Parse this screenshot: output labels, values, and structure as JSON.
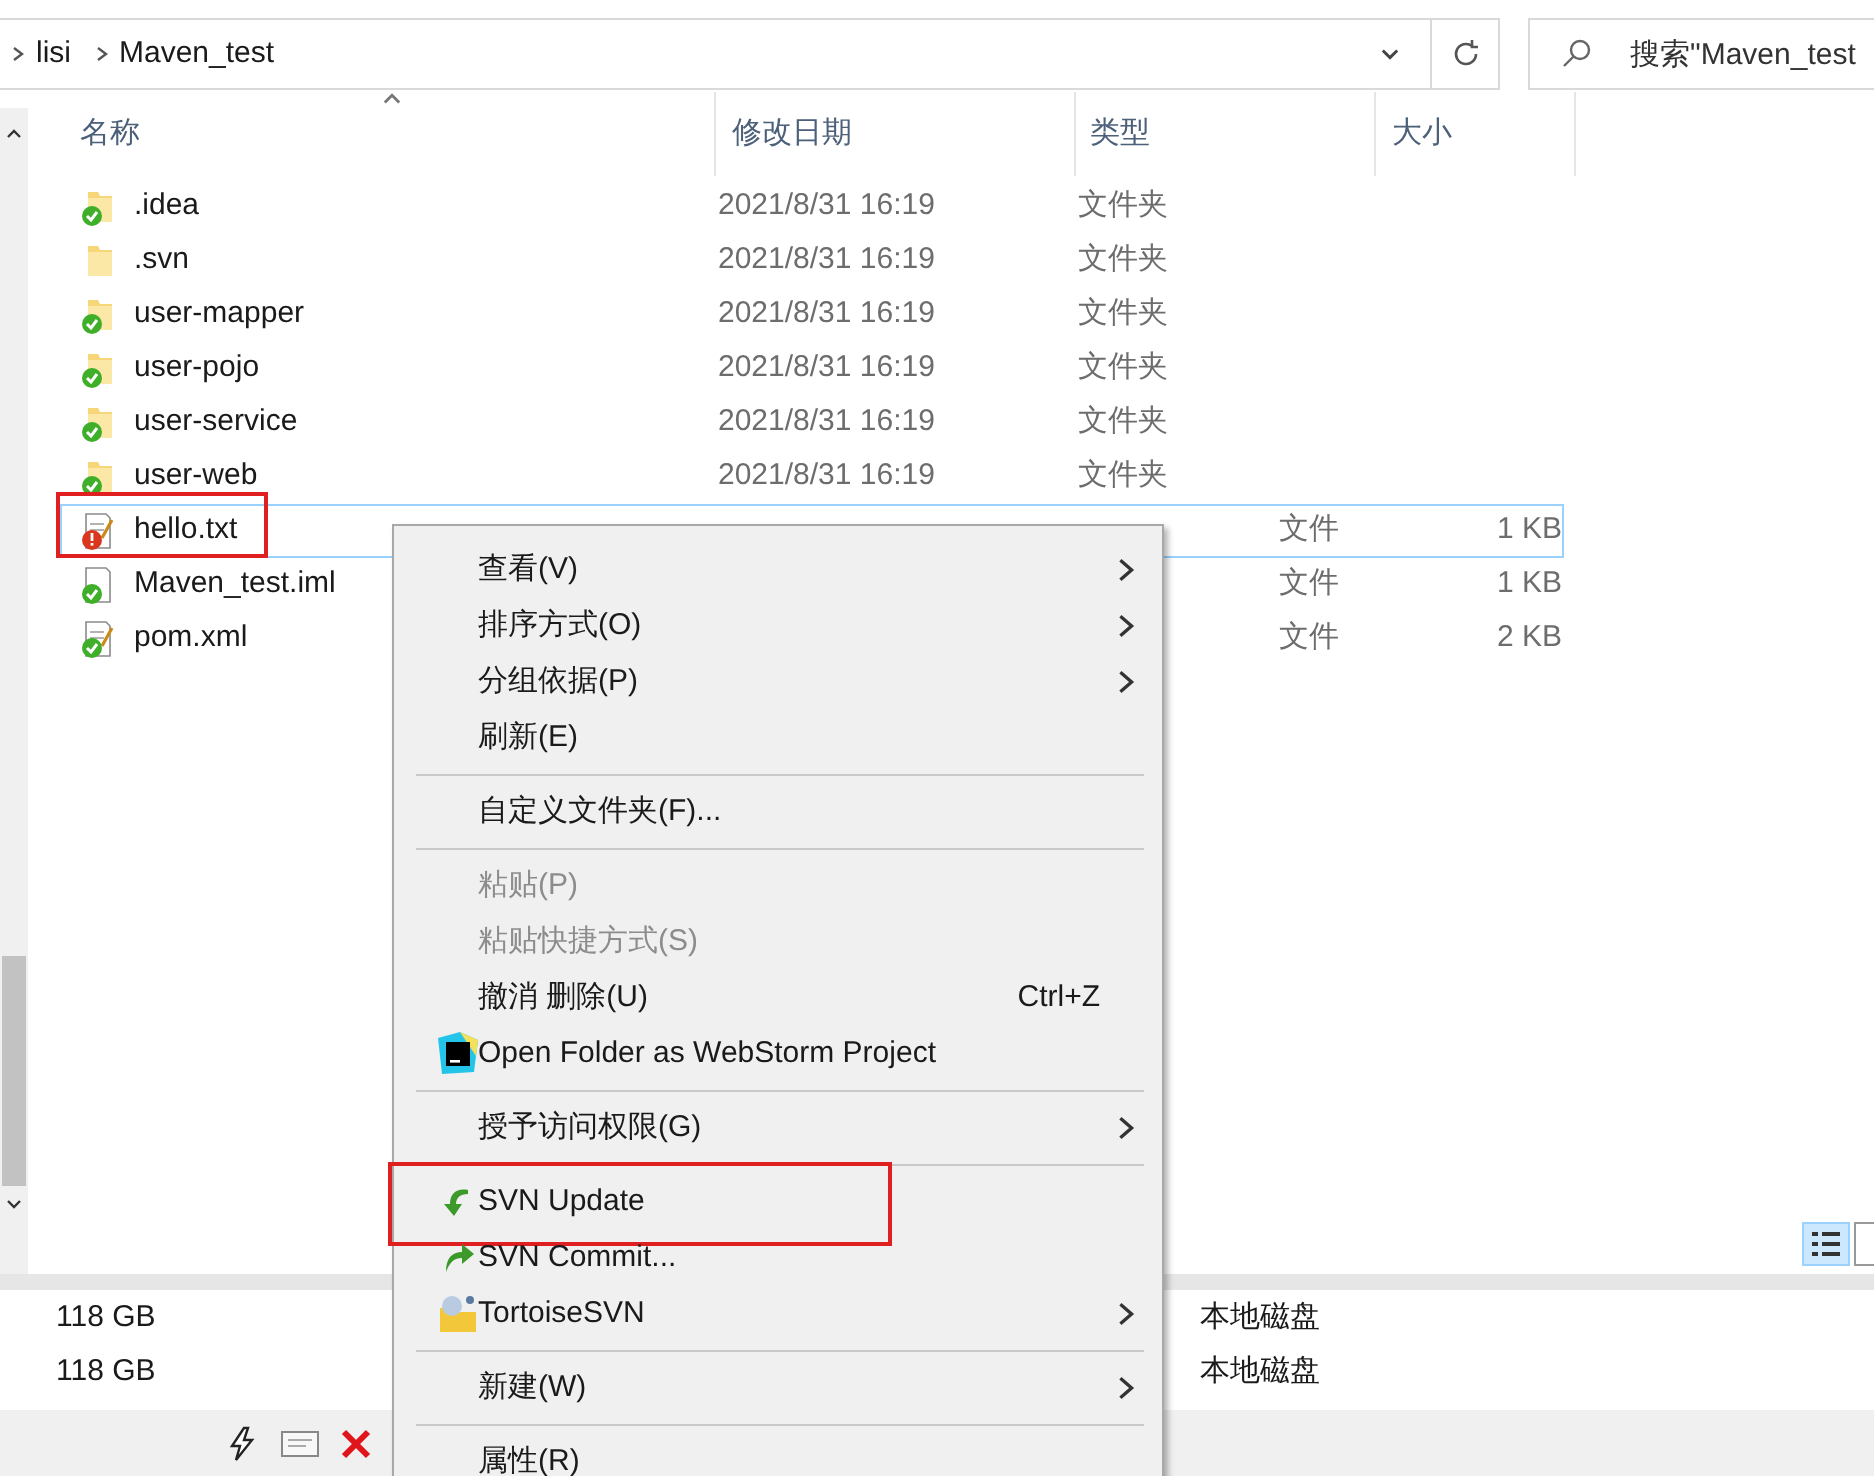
{
  "address_bar": {
    "breadcrumbs": [
      "lisi",
      "Maven_test"
    ]
  },
  "search": {
    "placeholder": "搜索\"Maven_test"
  },
  "columns": [
    "名称",
    "修改日期",
    "类型",
    "大小"
  ],
  "rows": [
    {
      "name": ".idea",
      "date": "2021/8/31 16:19",
      "type": "文件夹",
      "kind": "svn-folder",
      "selected": false,
      "annotated": false
    },
    {
      "name": ".svn",
      "date": "2021/8/31 16:19",
      "type": "文件夹",
      "kind": "folder",
      "selected": false,
      "annotated": false
    },
    {
      "name": "user-mapper",
      "date": "2021/8/31 16:19",
      "type": "文件夹",
      "kind": "svn-folder",
      "selected": false,
      "annotated": false
    },
    {
      "name": "user-pojo",
      "date": "2021/8/31 16:19",
      "type": "文件夹",
      "kind": "svn-folder",
      "selected": false,
      "annotated": false
    },
    {
      "name": "user-service",
      "date": "2021/8/31 16:19",
      "type": "文件夹",
      "kind": "svn-folder",
      "selected": false,
      "annotated": false
    },
    {
      "name": "user-web",
      "date": "2021/8/31 16:19",
      "type": "文件夹",
      "kind": "svn-folder",
      "selected": false,
      "annotated": false
    },
    {
      "name": "hello.txt",
      "type": "文件",
      "size": "1 KB",
      "kind": "modified-text",
      "selected": true,
      "annotated": true
    },
    {
      "name": "Maven_test.iml",
      "type": "文件",
      "size": "1 KB",
      "kind": "svn-file",
      "selected": false,
      "annotated": false
    },
    {
      "name": "pom.xml",
      "type": "文件",
      "size": "2 KB",
      "kind": "svn-text",
      "selected": false,
      "annotated": false
    }
  ],
  "drives": [
    {
      "size": "118 GB",
      "type": "本地磁盘"
    },
    {
      "size": "118 GB",
      "type": "本地磁盘"
    }
  ],
  "context_menu": [
    {
      "kind": "item",
      "label": "查看(V)",
      "submenu": true,
      "disabled": false,
      "annotated": false
    },
    {
      "kind": "item",
      "label": "排序方式(O)",
      "submenu": true,
      "disabled": false,
      "annotated": false
    },
    {
      "kind": "item",
      "label": "分组依据(P)",
      "submenu": true,
      "disabled": false,
      "annotated": false
    },
    {
      "kind": "item",
      "label": "刷新(E)",
      "submenu": false,
      "disabled": false,
      "annotated": false
    },
    {
      "kind": "separator"
    },
    {
      "kind": "item",
      "label": "自定义文件夹(F)...",
      "submenu": false,
      "disabled": false,
      "annotated": false
    },
    {
      "kind": "separator"
    },
    {
      "kind": "item",
      "label": "粘贴(P)",
      "submenu": false,
      "disabled": true,
      "annotated": false
    },
    {
      "kind": "item",
      "label": "粘贴快捷方式(S)",
      "submenu": false,
      "disabled": true,
      "annotated": false
    },
    {
      "kind": "item",
      "label": "撤消 删除(U)",
      "shortcut": "Ctrl+Z",
      "submenu": false,
      "disabled": false,
      "annotated": false
    },
    {
      "kind": "webstorm",
      "label": "Open Folder as WebStorm Project",
      "submenu": false,
      "disabled": false,
      "annotated": false
    },
    {
      "kind": "separator"
    },
    {
      "kind": "item",
      "label": "授予访问权限(G)",
      "submenu": true,
      "disabled": false,
      "annotated": false
    },
    {
      "kind": "separator"
    },
    {
      "kind": "svn-update",
      "label": "SVN Update",
      "submenu": false,
      "disabled": false,
      "annotated": true
    },
    {
      "kind": "svn-commit",
      "label": "SVN Commit...",
      "submenu": false,
      "disabled": false,
      "annotated": false
    },
    {
      "kind": "tortoise",
      "label": "TortoiseSVN",
      "submenu": true,
      "disabled": false,
      "annotated": false
    },
    {
      "kind": "separator"
    },
    {
      "kind": "item",
      "label": "新建(W)",
      "submenu": true,
      "disabled": false,
      "annotated": false
    },
    {
      "kind": "separator"
    },
    {
      "kind": "item",
      "label": "属性(R)",
      "submenu": false,
      "disabled": false,
      "annotated": false
    }
  ]
}
